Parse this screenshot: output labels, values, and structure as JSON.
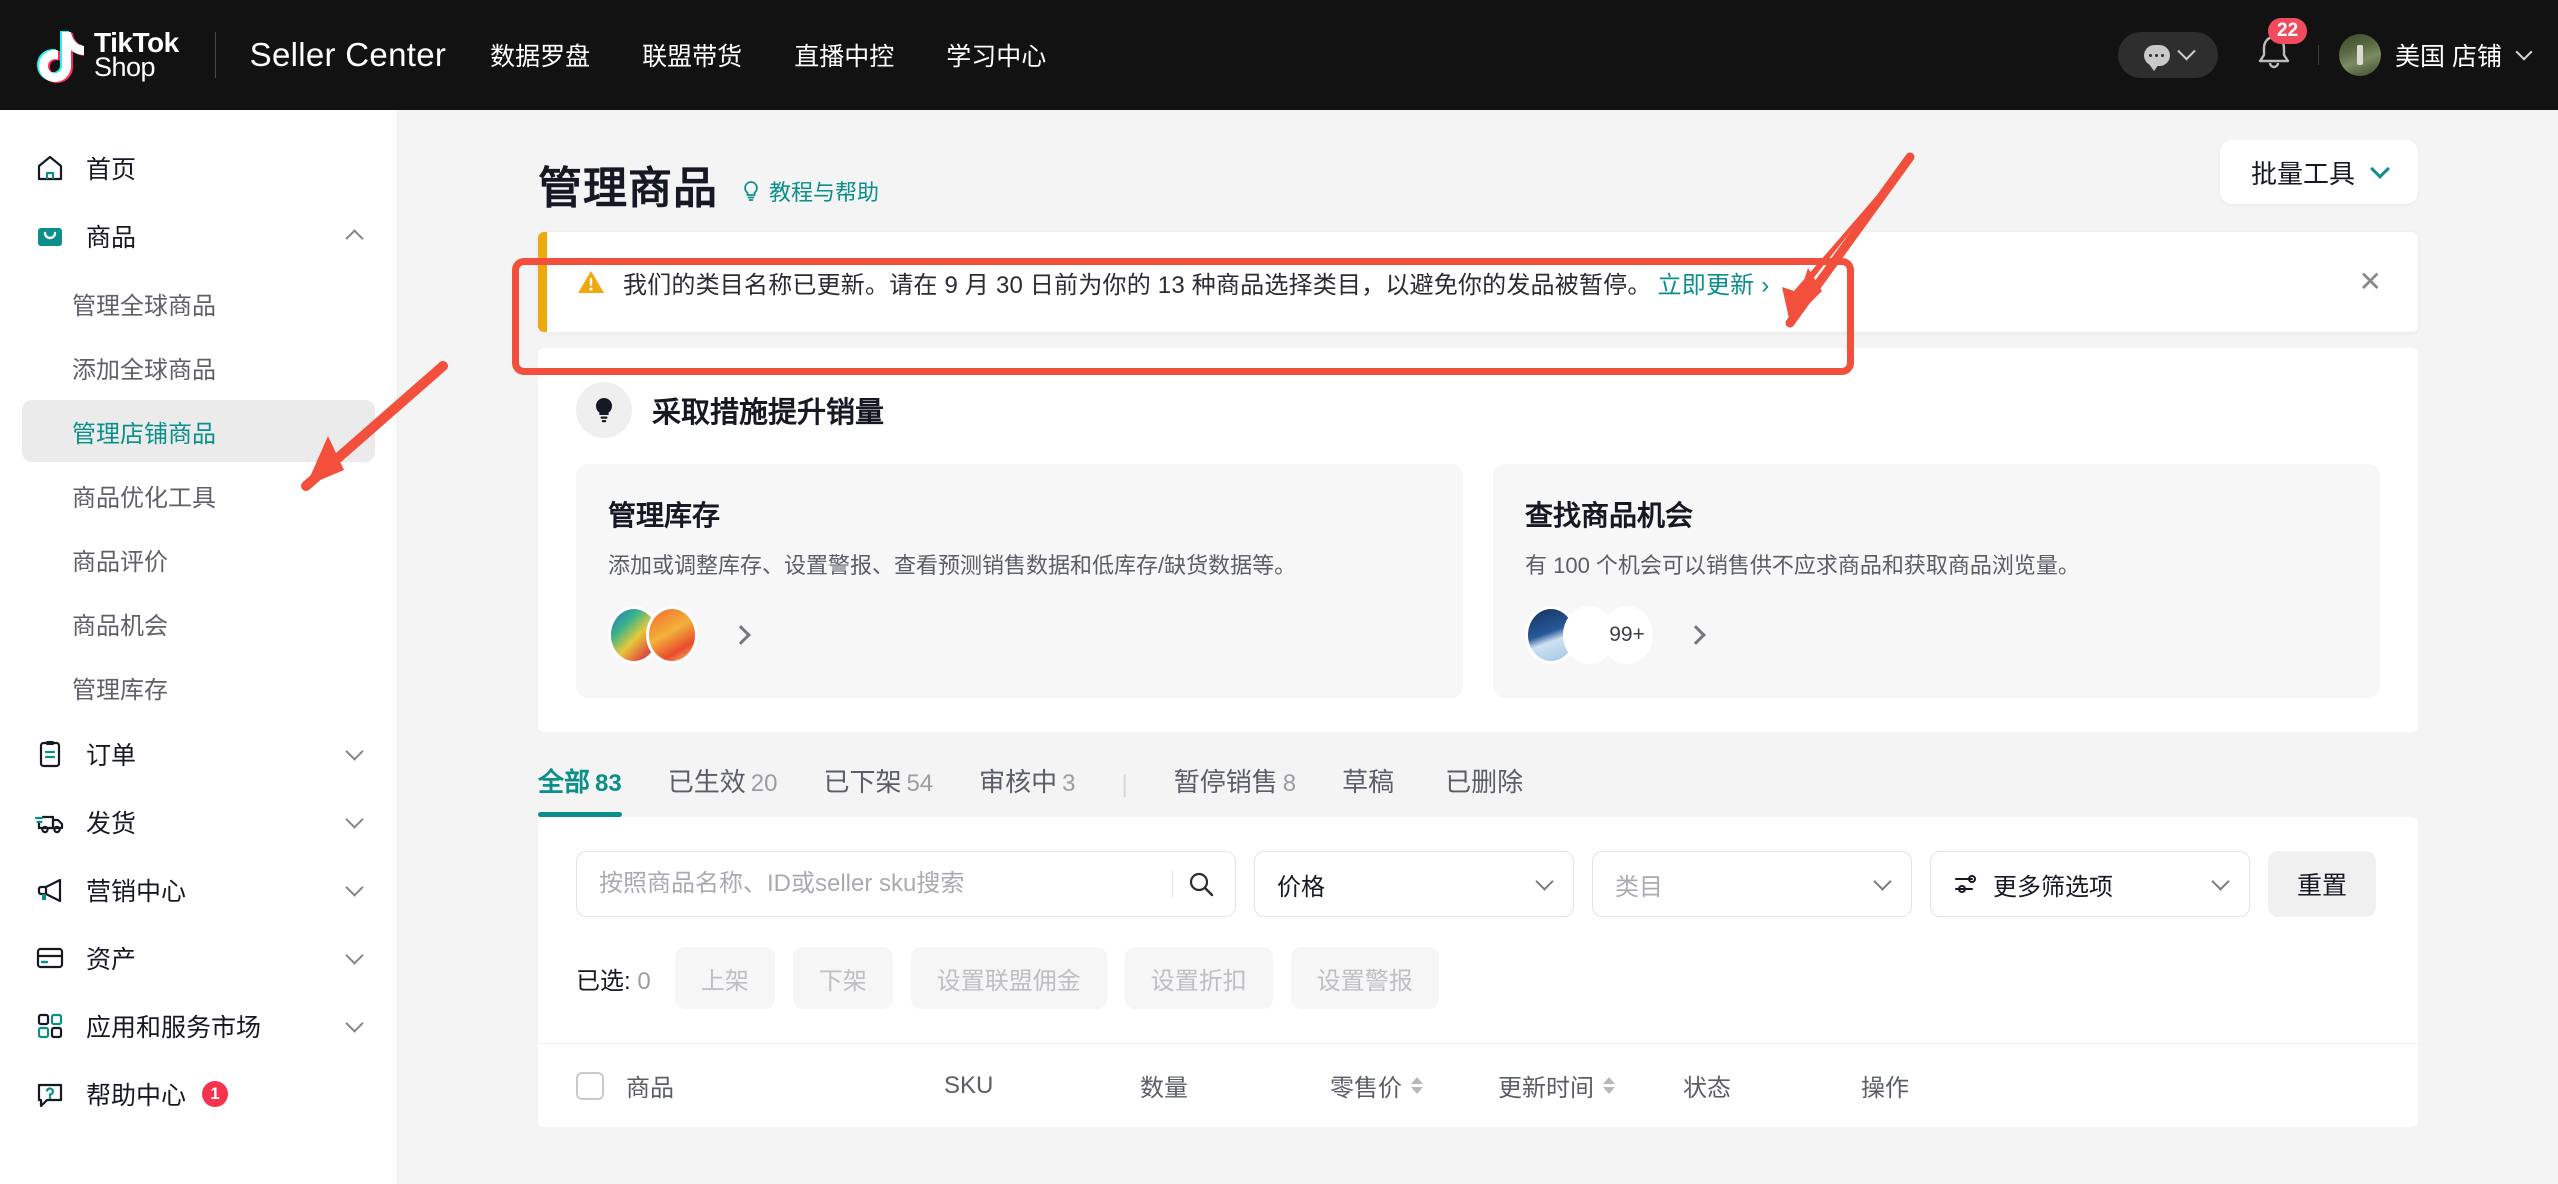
{
  "header": {
    "logo_line1": "TikTok",
    "logo_line2": "Shop",
    "brand": "Seller Center",
    "nav": [
      {
        "label": "数据罗盘"
      },
      {
        "label": "联盟带货"
      },
      {
        "label": "直播中控"
      },
      {
        "label": "学习中心"
      }
    ],
    "notification_count": "22",
    "shop_name": "美国 店铺"
  },
  "sidebar": {
    "items": [
      {
        "label": "首页",
        "icon": "home-icon",
        "type": "link"
      },
      {
        "label": "商品",
        "icon": "bag-icon",
        "type": "group",
        "expanded": true
      },
      {
        "label": "管理全球商品",
        "type": "sub"
      },
      {
        "label": "添加全球商品",
        "type": "sub"
      },
      {
        "label": "管理店铺商品",
        "type": "sub",
        "active": true
      },
      {
        "label": "商品优化工具",
        "type": "sub"
      },
      {
        "label": "商品评价",
        "type": "sub"
      },
      {
        "label": "商品机会",
        "type": "sub"
      },
      {
        "label": "管理库存",
        "type": "sub"
      },
      {
        "label": "订单",
        "icon": "clipboard-icon",
        "type": "group"
      },
      {
        "label": "发货",
        "icon": "truck-icon",
        "type": "group"
      },
      {
        "label": "营销中心",
        "icon": "megaphone-icon",
        "type": "group"
      },
      {
        "label": "资产",
        "icon": "card-icon",
        "type": "group"
      },
      {
        "label": "应用和服务市场",
        "icon": "apps-icon",
        "type": "group"
      },
      {
        "label": "帮助中心",
        "icon": "help-chat-icon",
        "type": "link",
        "badge": "1"
      }
    ]
  },
  "page": {
    "title": "管理商品",
    "help_link": "教程与帮助",
    "batch_tools": "批量工具"
  },
  "alert": {
    "text": "我们的类目名称已更新。请在 9 月 30 日前为你的 13 种商品选择类目，以避免你的发品被暂停。",
    "cta": "立即更新 ›",
    "close": "✕"
  },
  "boost": {
    "title": "采取措施提升销量",
    "cards": [
      {
        "title": "管理库存",
        "desc": "添加或调整库存、设置警报、查看预测销售数据和低库存/缺货数据等。",
        "count": ""
      },
      {
        "title": "查找商品机会",
        "desc": "有 100 个机会可以销售供不应求商品和获取商品浏览量。",
        "count": "99+"
      }
    ]
  },
  "tabs": [
    {
      "label": "全部",
      "count": "83",
      "active": true
    },
    {
      "label": "已生效",
      "count": "20"
    },
    {
      "label": "已下架",
      "count": "54"
    },
    {
      "label": "审核中",
      "count": "3"
    },
    {
      "label": "暂停销售",
      "count": "8"
    },
    {
      "label": "草稿",
      "count": ""
    },
    {
      "label": "已删除",
      "count": ""
    }
  ],
  "filters": {
    "search_placeholder": "按照商品名称、ID或seller sku搜索",
    "search_value": "",
    "price_label": "价格",
    "category_label": "类目",
    "more_label": "更多筛选项",
    "reset_label": "重置"
  },
  "bulk": {
    "selected_label": "已选:",
    "selected_count": "0",
    "buttons": [
      {
        "label": "上架"
      },
      {
        "label": "下架"
      },
      {
        "label": "设置联盟佣金"
      },
      {
        "label": "设置折扣"
      },
      {
        "label": "设置警报"
      }
    ]
  },
  "table": {
    "columns": [
      {
        "label": "商品",
        "sortable": false
      },
      {
        "label": "SKU",
        "sortable": false
      },
      {
        "label": "数量",
        "sortable": false
      },
      {
        "label": "零售价",
        "sortable": true
      },
      {
        "label": "更新时间",
        "sortable": true
      },
      {
        "label": "状态",
        "sortable": false
      },
      {
        "label": "操作",
        "sortable": false
      }
    ]
  },
  "colors": {
    "accent": "#0b8f8a",
    "warning": "#f0a80f",
    "danger": "#f2503c",
    "badge": "#f24b5e",
    "header_bg": "#121212"
  }
}
